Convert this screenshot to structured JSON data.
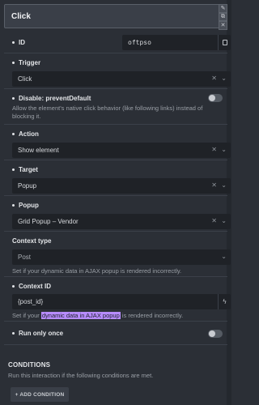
{
  "header": {
    "title": "Click",
    "buttons": [
      "pencil-icon",
      "copy-icon",
      "delete-icon"
    ]
  },
  "id_row": {
    "label": "ID",
    "value": "oftpso"
  },
  "trigger": {
    "label": "Trigger",
    "value": "Click"
  },
  "prevent_default": {
    "label": "Disable: preventDefault",
    "help": "Allow the element's native click behavior (like following links) instead of blocking it.",
    "enabled": false
  },
  "action": {
    "label": "Action",
    "value": "Show element"
  },
  "target": {
    "label": "Target",
    "value": "Popup"
  },
  "popup": {
    "label": "Popup",
    "value": "Grid Popup – Vendor"
  },
  "context_type": {
    "label": "Context type",
    "value": "Post",
    "help": "Set if your dynamic data in AJAX popup is rendered incorrectly."
  },
  "context_id": {
    "label": "Context ID",
    "value": "{post_id}",
    "help_prefix": "Set if your ",
    "help_highlight": "dynamic data in AJAX popup",
    "help_suffix": " is rendered incorrectly."
  },
  "run_once": {
    "label": "Run only once",
    "enabled": false
  },
  "conditions": {
    "title": "CONDITIONS",
    "help": "Run this interaction if the following conditions are met.",
    "add_button": "+ ADD CONDITION"
  }
}
